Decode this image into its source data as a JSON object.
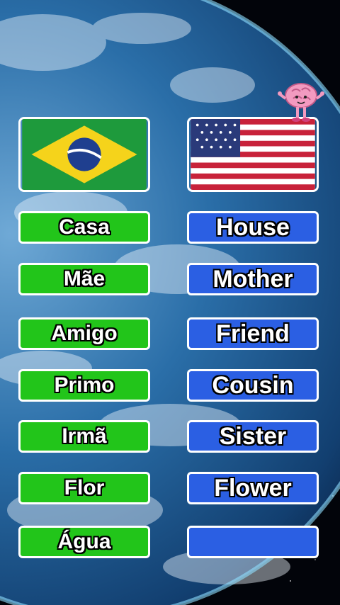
{
  "pairs": [
    {
      "pt": "Casa",
      "en": "House"
    },
    {
      "pt": "Mãe",
      "en": "Mother"
    },
    {
      "pt": "Amigo",
      "en": "Friend"
    },
    {
      "pt": "Primo",
      "en": "Cousin"
    },
    {
      "pt": "Irmã",
      "en": "Sister"
    },
    {
      "pt": "Flor",
      "en": "Flower"
    },
    {
      "pt": "Água",
      "en": ""
    }
  ],
  "colors": {
    "portuguese_box": "#22c51a",
    "english_box": "#2b5fe3",
    "border": "#ffffff"
  },
  "icons": {
    "left_flag": "brazil-flag",
    "right_flag": "usa-flag",
    "mascot": "brain-mascot-icon"
  }
}
